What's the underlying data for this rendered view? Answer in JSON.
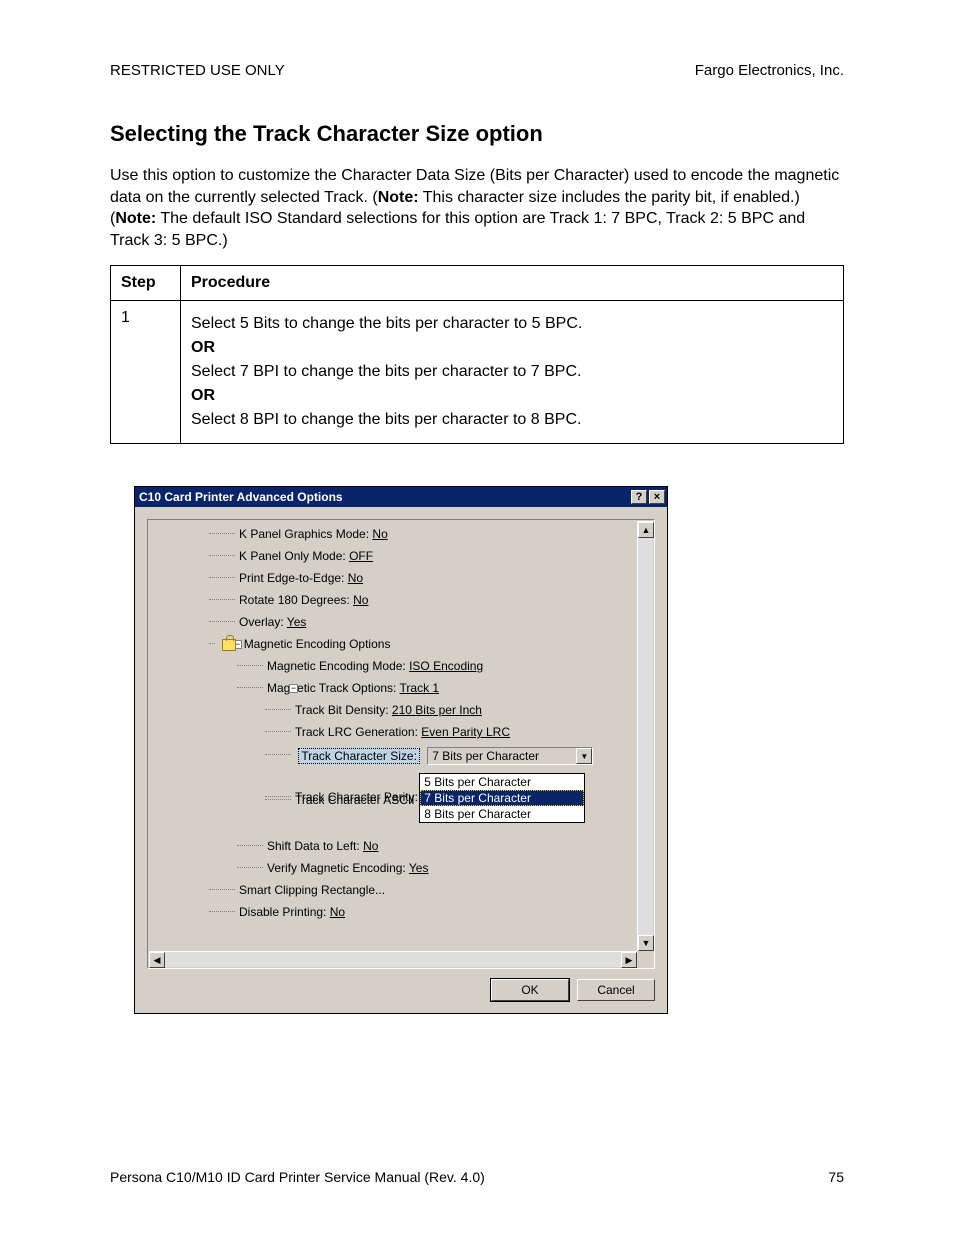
{
  "header": {
    "left": "RESTRICTED USE ONLY",
    "right": "Fargo Electronics, Inc."
  },
  "title": "Selecting the Track Character Size option",
  "intro": {
    "p1a": "Use this option to customize the Character Data Size (Bits per Character) used to encode the magnetic data on the currently selected Track.  (",
    "note1_label": "Note:",
    "p1b": "  This character size includes the parity bit, if enabled.)  (",
    "note2_label": "Note:",
    "p1c": "  The default ISO Standard selections for this option are Track 1: 7 BPC, Track 2: 5 BPC and Track 3: 5 BPC.)"
  },
  "table": {
    "h_step": "Step",
    "h_proc": "Procedure",
    "row": {
      "num": "1",
      "l1": "Select 5 Bits to change the bits per character to 5 BPC.",
      "or1": "OR",
      "l2": "Select 7 BPI to change the bits per character to 7 BPC.",
      "or2": "OR",
      "l3": "Select 8 BPI to change the bits per character to 8 BPC."
    }
  },
  "dialog": {
    "title": "C10 Card Printer Advanced Options",
    "help": "?",
    "close": "×",
    "tree": {
      "n0": {
        "label": "K Panel Graphics Mode: ",
        "val": "No"
      },
      "n1": {
        "label": "K Panel Only Mode: ",
        "val": "OFF"
      },
      "n2": {
        "label": "Print Edge-to-Edge: ",
        "val": "No"
      },
      "n3": {
        "label": "Rotate 180 Degrees: ",
        "val": "No"
      },
      "n4": {
        "label": "Overlay: ",
        "val": "Yes"
      },
      "n5": {
        "label": "Magnetic Encoding Options"
      },
      "n6": {
        "label": "Magnetic Encoding Mode: ",
        "val": "ISO Encoding"
      },
      "n7": {
        "label": "Magnetic Track Options: ",
        "val": "Track 1"
      },
      "n8": {
        "label": "Track Bit Density: ",
        "val": "210 Bits per Inch"
      },
      "n9": {
        "label": "Track LRC Generation: ",
        "val": "Even Parity LRC"
      },
      "n10": {
        "label": "Track Character Size:"
      },
      "n11": {
        "label": "Track Character Parity:"
      },
      "n12": {
        "label": "Track Character ASCII"
      },
      "n13": {
        "label": "Shift Data to Left: ",
        "val": "No"
      },
      "n14": {
        "label": "Verify Magnetic Encoding: ",
        "val": "Yes"
      },
      "n15": {
        "label": "Smart Clipping Rectangle..."
      },
      "n16": {
        "label": "Disable Printing: ",
        "val": "No"
      }
    },
    "dropdown": {
      "value": "7 Bits per Character",
      "opt1": "5 Bits per Character",
      "opt2": "7 Bits per Character",
      "opt3": "8 Bits per Character"
    },
    "ok": "OK",
    "cancel": "Cancel"
  },
  "footer": {
    "left": "Persona C10/M10 ID Card Printer Service Manual (Rev. 4.0)",
    "right": "75"
  },
  "glyph": {
    "up": "▲",
    "down": "▼",
    "left": "◀",
    "right": "▶",
    "minus": "−"
  }
}
